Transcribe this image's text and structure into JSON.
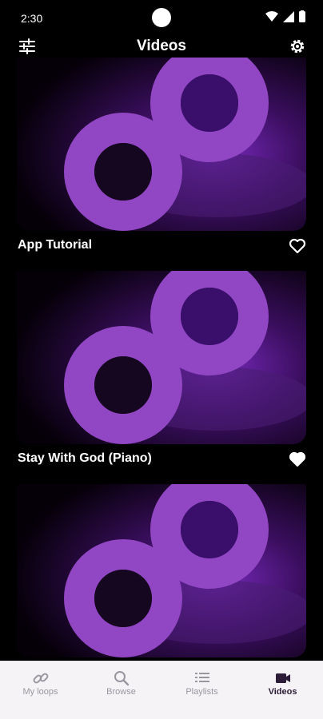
{
  "status_bar": {
    "time": "2:30"
  },
  "header": {
    "title": "Videos",
    "left_icon": "tune-icon",
    "right_icon": "gear-icon"
  },
  "videos": [
    {
      "title": "App Tutorial",
      "favorite": false
    },
    {
      "title": "Stay With God (Piano)",
      "favorite": true
    },
    {
      "title": "",
      "favorite": false
    }
  ],
  "bottom_nav": {
    "items": [
      {
        "label": "My loops",
        "icon": "loop-link-icon",
        "active": false
      },
      {
        "label": "Browse",
        "icon": "search-icon",
        "active": false
      },
      {
        "label": "Playlists",
        "icon": "playlist-icon",
        "active": false
      },
      {
        "label": "Videos",
        "icon": "video-camera-icon",
        "active": true
      }
    ]
  },
  "colors": {
    "accent": "#9b4fc9",
    "thumb_shape": "#9146c3",
    "thumb_dark": "#0a0010",
    "nav_bg": "#f6f3f7",
    "nav_active": "#2b1d37",
    "nav_inactive": "#9a96a0"
  }
}
